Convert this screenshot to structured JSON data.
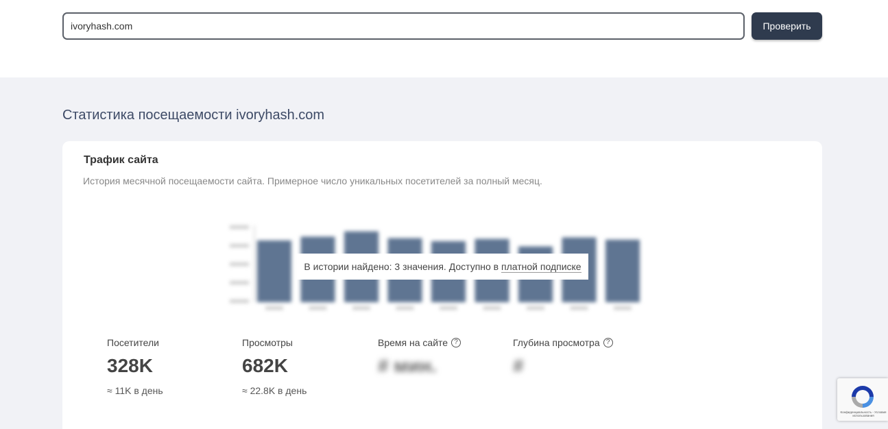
{
  "search": {
    "value": "ivoryhash.com",
    "button_label": "Проверить"
  },
  "section": {
    "title": "Статистика посещаемости ivoryhash.com"
  },
  "traffic_card": {
    "title": "Трафик сайта",
    "description": "История месячной посещаемости сайта. Примерное число уникальных посетителей за полный месяц.",
    "overlay_prefix": "В истории найдено: 3 значения. Доступно в ",
    "overlay_link": "платной подписке"
  },
  "chart_data": {
    "type": "bar",
    "values": [
      0.82,
      0.87,
      0.94,
      0.85,
      0.81,
      0.84,
      0.74,
      0.86,
      0.83
    ],
    "blurred": true,
    "bar_color": "#5f7592"
  },
  "metrics": [
    {
      "label": "Посетители",
      "value": "328K",
      "sub": "≈ 11K в день",
      "help": false
    },
    {
      "label": "Просмотры",
      "value": "682K",
      "sub": "≈ 22.8K в день",
      "help": false
    },
    {
      "label": "Время на сайте",
      "value": "# мин.",
      "sub": "",
      "help": true,
      "blurred": true
    },
    {
      "label": "Глубина просмотра",
      "value": "#",
      "sub": "",
      "help": true,
      "blurred": true
    }
  ],
  "colors": {
    "button": "#2f3b4e",
    "title": "#3d4a66",
    "background": "#f1f2f6"
  },
  "recaptcha": {
    "text": "Конфиденциальность - Условия использования"
  }
}
